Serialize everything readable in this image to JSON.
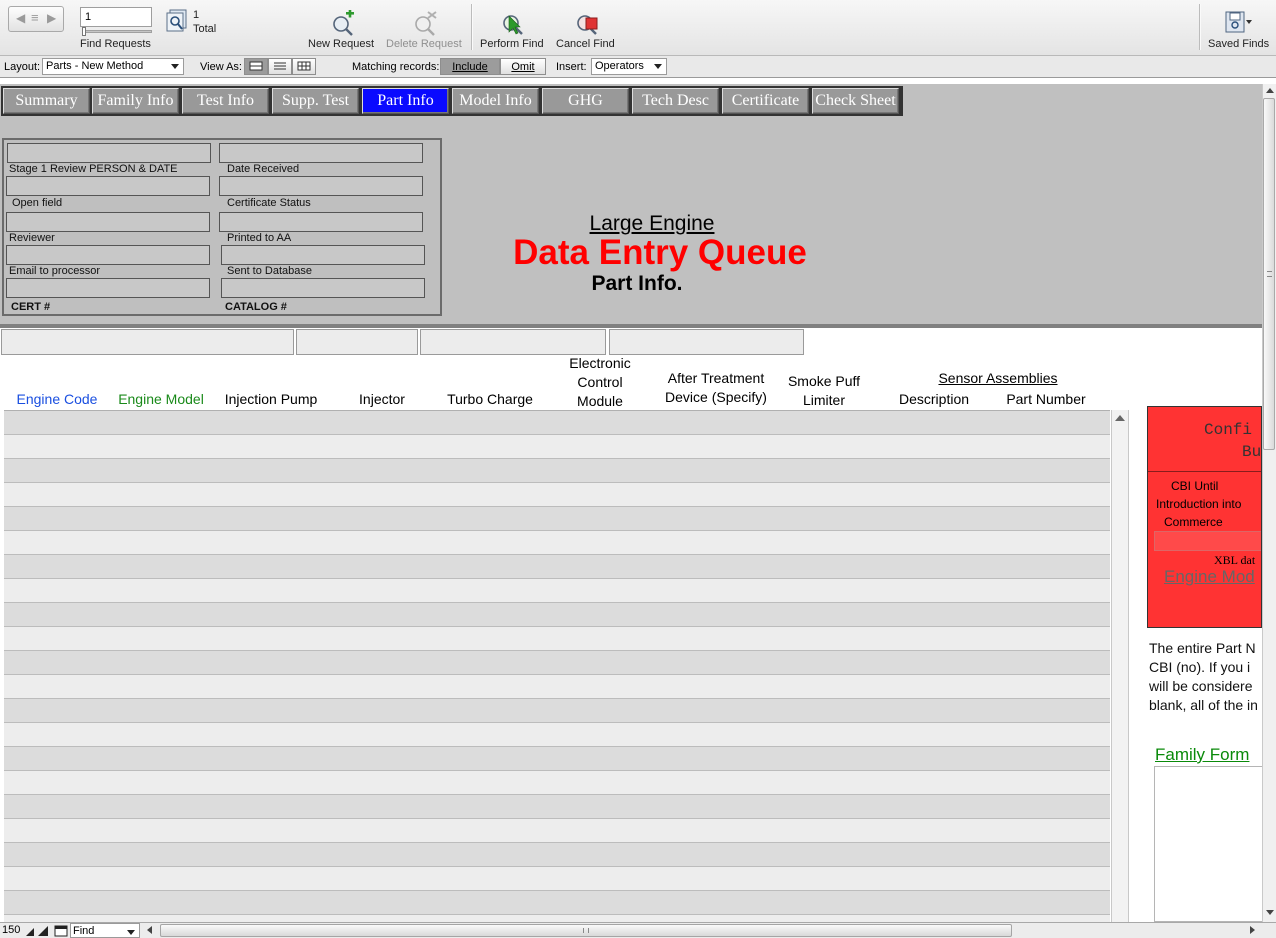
{
  "toolbar": {
    "record_number": "1",
    "total_count": "1",
    "total_label": "Total",
    "find_requests_label": "Find Requests",
    "new_request_label": "New Request",
    "delete_request_label": "Delete Request",
    "perform_find_label": "Perform Find",
    "cancel_find_label": "Cancel Find",
    "saved_finds_label": "Saved Finds"
  },
  "layoutbar": {
    "layout_label": "Layout:",
    "layout_value": "Parts - New Method",
    "view_as_label": "View As:",
    "matching_label": "Matching records:",
    "include_label": "Include",
    "omit_label": "Omit",
    "insert_label": "Insert:",
    "insert_value": "Operators"
  },
  "tabs": [
    {
      "label": "Summary"
    },
    {
      "label": "Family Info"
    },
    {
      "label": "Test Info"
    },
    {
      "label": "Supp. Test"
    },
    {
      "label": "Part Info"
    },
    {
      "label": "Model Info"
    },
    {
      "label": "GHG"
    },
    {
      "label": "Tech Desc"
    },
    {
      "label": "Certificate"
    },
    {
      "label": "Check Sheet"
    }
  ],
  "review": {
    "stage1": "Stage 1 Review PERSON & DATE",
    "date_received": "Date  Received",
    "open_field": "Open field",
    "certificate_status": "Certificate Status",
    "reviewer": "Reviewer",
    "printed_to_aa": "Printed to AA",
    "email_to_processor": "Email to processor",
    "sent_to_database": "Sent to Database",
    "cert_no": "CERT #",
    "catalog_no": "CATALOG #"
  },
  "titles": {
    "line1": "Large Engine",
    "line2": "Data Entry Queue",
    "line3": "Part Info."
  },
  "columns": {
    "engine_code": "Engine Code",
    "engine_model": "Engine Model",
    "injection_pump": "Injection Pump",
    "injector": "Injector",
    "turbo_charge": "Turbo Charge",
    "ecm_line1": "Electronic",
    "ecm_line2": "Control",
    "ecm_line3": "Module",
    "atd_line1": "After Treatment",
    "atd_line2": "Device (Specify)",
    "spl_line1": "Smoke Puff",
    "spl_line2": "Limiter",
    "sensor_assemblies": "Sensor Assemblies",
    "description": "Description",
    "part_number": "Part Number"
  },
  "side": {
    "confidential_line1": "Confi",
    "confidential_line2": "Bus",
    "cbi_line1": "CBI Until",
    "cbi_line2": "Introduction into",
    "cbi_line3": "Commerce",
    "xbl_text": "XBL dat",
    "engine_model_link": "Engine Mod",
    "note_line1": "The entire Part N",
    "note_line2": "CBI (no).  If you i",
    "note_line3": "will be considere",
    "note_line4": "blank, all of the in",
    "family_form_link": "Family Form"
  },
  "status": {
    "zoom": "150",
    "mode": "Find"
  },
  "colors": {
    "active_tab": "#0a0aff",
    "title_red": "#ff0000",
    "engine_code_blue": "#1a4fe0",
    "engine_model_green": "#1a8a1a",
    "confidential_panel": "#ff3333"
  }
}
